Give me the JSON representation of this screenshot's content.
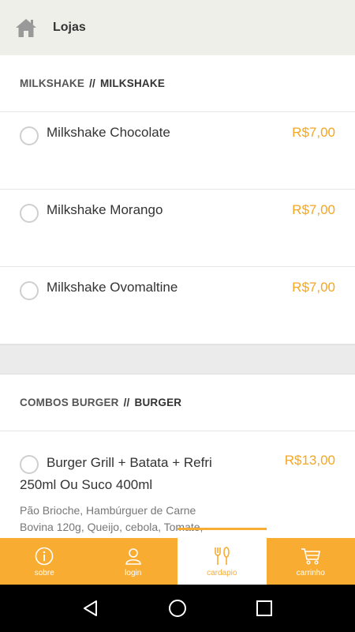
{
  "appbar": {
    "title": "Lojas",
    "home_icon": "home-icon"
  },
  "sections": [
    {
      "category": "MILKSHAKE",
      "separator": "//",
      "subcategory": "MILKSHAKE",
      "items": [
        {
          "name": "Milkshake Chocolate",
          "price": "R$7,00"
        },
        {
          "name": "Milkshake Morango",
          "price": "R$7,00"
        },
        {
          "name": "Milkshake Ovomaltine",
          "price": "R$7,00"
        }
      ]
    },
    {
      "category": "COMBOS BURGER",
      "separator": "//",
      "subcategory": "BURGER",
      "items": [
        {
          "name_line1": "Burger Grill + Batata + Refri",
          "name_line2": "250ml Ou Suco 400ml",
          "price": "R$13,00",
          "description": "Pão Brioche, Hambúrguer de Carne Bovina 120g, Queijo, cebola, Tomate, Alface, Molho Especial"
        }
      ]
    }
  ],
  "tabs": [
    {
      "label": "sobre",
      "icon": "info-icon"
    },
    {
      "label": "login",
      "icon": "user-icon"
    },
    {
      "label": "cardapio",
      "icon": "cutlery-icon",
      "active": true
    },
    {
      "label": "carrinho",
      "icon": "cart-icon"
    }
  ],
  "colors": {
    "accent": "#f9ac32",
    "price": "#f5a623",
    "appbar_bg": "#efefe9"
  }
}
